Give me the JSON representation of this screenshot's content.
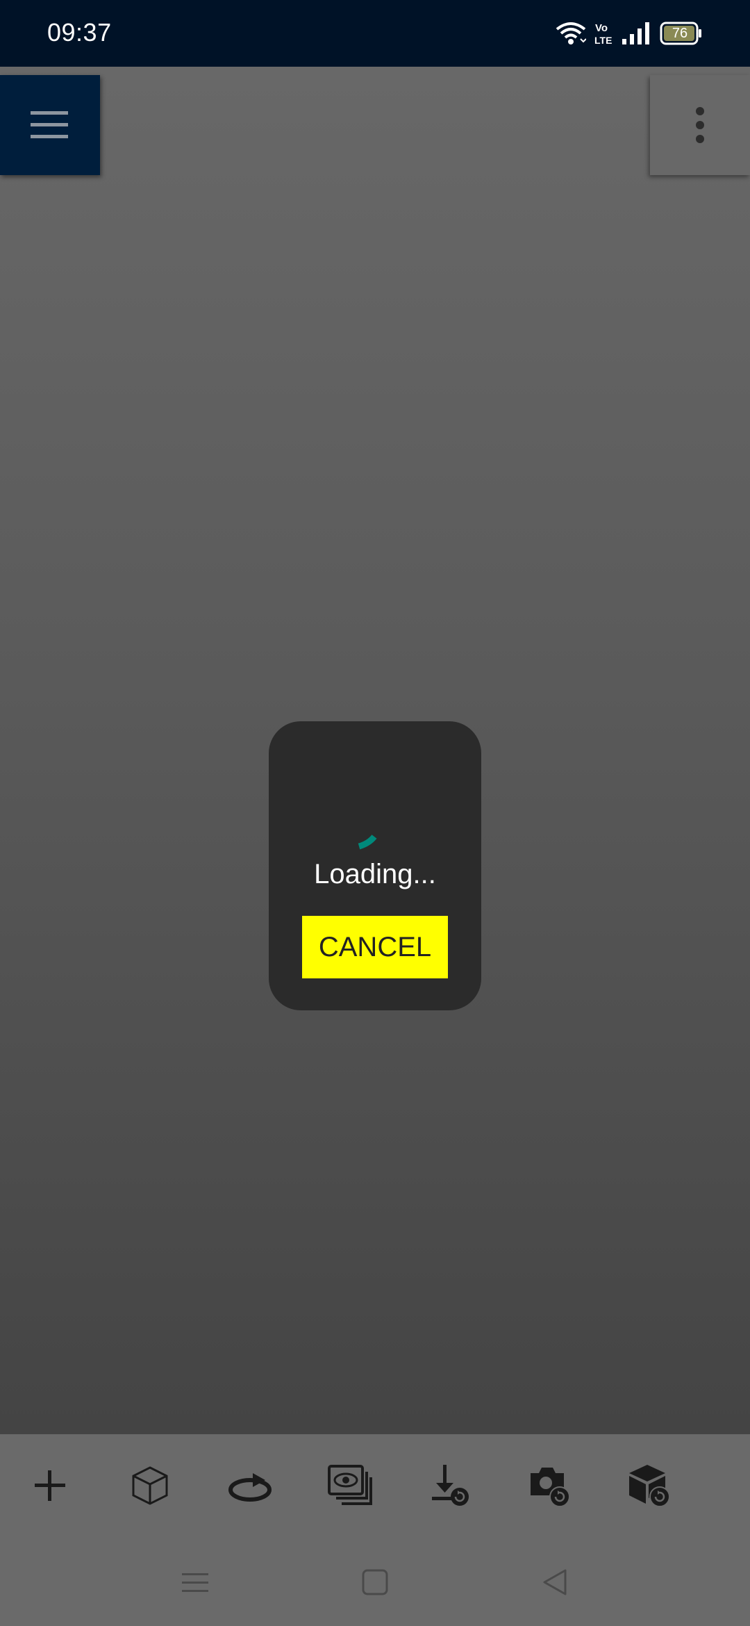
{
  "status_bar": {
    "time": "09:37",
    "battery_level": "76",
    "icons": [
      "wifi-icon",
      "volte-icon",
      "signal-icon",
      "battery-icon"
    ]
  },
  "top_controls": {
    "menu_icon": "hamburger-menu-icon",
    "overflow_icon": "more-vert-icon"
  },
  "dialog": {
    "loading_text": "Loading...",
    "cancel_label": "CANCEL",
    "spinner_color": "#00897b",
    "cancel_color": "#ffff00"
  },
  "toolbar": {
    "tools": [
      {
        "name": "add-icon"
      },
      {
        "name": "cube-icon"
      },
      {
        "name": "rotate-icon"
      },
      {
        "name": "view-layers-icon"
      },
      {
        "name": "download-reset-icon"
      },
      {
        "name": "camera-reset-icon"
      },
      {
        "name": "cube-reset-icon"
      }
    ]
  },
  "nav_bar": {
    "buttons": [
      "recents-icon",
      "home-icon",
      "back-icon"
    ]
  },
  "colors": {
    "status_bar_bg": "#001227",
    "menu_button_bg": "#001e3c",
    "dialog_bg": "#2b2b2b",
    "toolbar_bg": "#6a6a6a"
  }
}
